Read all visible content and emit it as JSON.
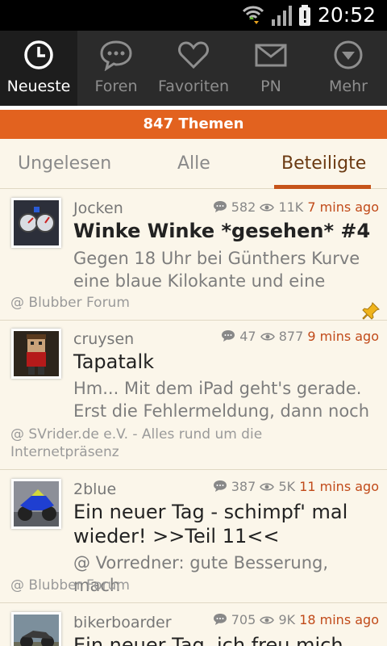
{
  "status_bar": {
    "time": "20:52"
  },
  "nav": {
    "items": [
      {
        "label": "Neueste",
        "icon": "clock-icon",
        "active": true
      },
      {
        "label": "Foren",
        "icon": "chat-bubble-icon"
      },
      {
        "label": "Favoriten",
        "icon": "heart-icon"
      },
      {
        "label": "PN",
        "icon": "envelope-icon"
      },
      {
        "label": "Mehr",
        "icon": "chevron-down-icon"
      }
    ]
  },
  "banner": {
    "text": "847 Themen"
  },
  "tabs": [
    {
      "label": "Ungelesen"
    },
    {
      "label": "Alle"
    },
    {
      "label": "Beteiligte",
      "active": true
    }
  ],
  "topics": [
    {
      "author": "Jocken",
      "replies": "582",
      "views": "11K",
      "time": "7 mins ago",
      "title": "Winke Winke *gesehen* #4",
      "snippet": "Gegen 18 Uhr bei Günthers Kurve eine blaue Kilokante und eine",
      "forum": "@ Blubber Forum"
    },
    {
      "author": "cruysen",
      "replies": "47",
      "views": "877",
      "time": "9 mins ago",
      "title": "Tapatalk",
      "snippet": "Hm... Mit dem iPad geht's gerade. Erst die Fehlermeldung, dann noch",
      "forum": "@ SVrider.de e.V. - Alles rund um die Internetpräsenz"
    },
    {
      "author": "2blue",
      "replies": "387",
      "views": "5K",
      "time": "11 mins ago",
      "title": "Ein neuer Tag - schimpf' mal wieder! >>Teil 11<<",
      "snippet": "@ Vorredner: gute Besserung, mach",
      "forum": "@ Blubber Forum"
    },
    {
      "author": "bikerboarder",
      "replies": "705",
      "views": "9K",
      "time": "18 mins ago",
      "title": "Ein neuer Tag, ich freu mich",
      "snippet": "",
      "forum": ""
    }
  ],
  "colors": {
    "accent": "#e2621f",
    "time": "#c14a19",
    "nav_bg": "#2b2b2b"
  }
}
